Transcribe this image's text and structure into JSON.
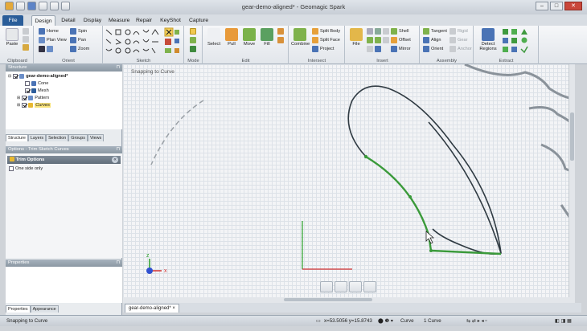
{
  "window": {
    "title": "gear-demo-aligned* - Geomagic Spark",
    "min_label": "–",
    "max_label": "□",
    "close_label": "✕"
  },
  "tabs": [
    "File",
    "Design",
    "Detail",
    "Display",
    "Measure",
    "Repair",
    "KeyShot 3",
    "Capture"
  ],
  "ribbon": {
    "clipboard": {
      "label": "Clipboard",
      "paste": "Paste"
    },
    "orient": {
      "label": "Orient",
      "home": "Home",
      "spin": "Spin",
      "plan_view": "Plan View",
      "pan": "Pan",
      "zoom": "Zoom"
    },
    "sketch": {
      "label": "Sketch"
    },
    "mode": {
      "label": "Mode"
    },
    "edit": {
      "label": "Edit",
      "select": "Select",
      "pull": "Pull",
      "move": "Move",
      "fill": "Fill"
    },
    "intersect": {
      "label": "Intersect",
      "combine": "Combine",
      "split_body": "Split Body",
      "split_face": "Split Face",
      "project": "Project"
    },
    "insert": {
      "label": "Insert",
      "file": "File",
      "shell": "Shell",
      "offset": "Offset",
      "mirror": "Mirror"
    },
    "assembly": {
      "label": "Assembly",
      "tangent": "Tangent",
      "align": "Align",
      "orient": "Orient",
      "rigid": "Rigid",
      "gear": "Gear",
      "anchor": "Anchor"
    },
    "extract": {
      "label": "Extract",
      "detect_regions": "Detect Regions"
    }
  },
  "structure": {
    "title": "Structure",
    "items": [
      {
        "label": "gear-demo-aligned*",
        "checked": true
      },
      {
        "label": "Cone",
        "checked": false
      },
      {
        "label": "Mesh",
        "checked": true
      },
      {
        "label": "Pattern",
        "checked": true
      },
      {
        "label": "Curves",
        "checked": true
      }
    ],
    "tabs": [
      "Structure",
      "Layers",
      "Selection",
      "Groups",
      "Views"
    ]
  },
  "options": {
    "title": "Options - Trim Sketch Curves",
    "section": "Trim Options",
    "checkbox_label": "One side only"
  },
  "properties": {
    "title": "Properties",
    "tabs": [
      "Properties",
      "Appearance"
    ]
  },
  "viewport": {
    "mode_label": "Snapping to Curve",
    "axis_x": "x",
    "axis_z": "z"
  },
  "doc_tab": {
    "label": "gear-demo-aligned*",
    "close": "×"
  },
  "status": {
    "left": "Snapping to Curve",
    "coords": "x=53.5056  y=15.8743",
    "filter": "Curve",
    "selection": "1 Curve"
  },
  "colors": {
    "file_tab": "#2a5d99",
    "selection_green": "#3a9a3a",
    "curve_dark": "#2f3a42",
    "axis_red": "#d03030",
    "axis_green": "#2aa02a",
    "axis_blue": "#3050d0"
  }
}
